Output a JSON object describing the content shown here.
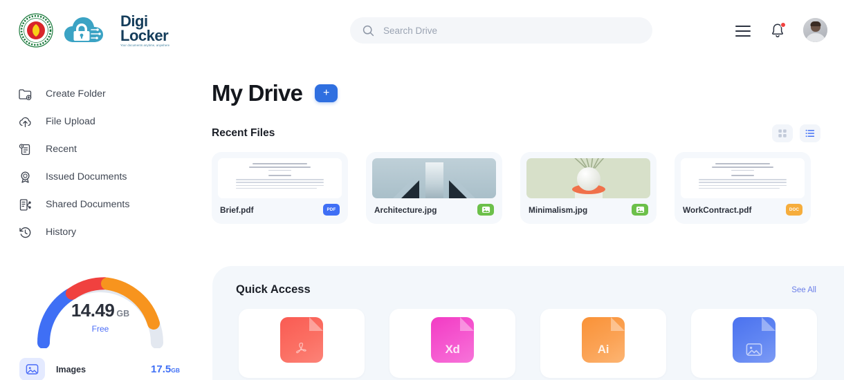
{
  "brand": {
    "seal_name": "bangladesh-government-seal",
    "digi": "Digi",
    "locker": "Locker",
    "tagline": "Your documents anytime, anywhere"
  },
  "search": {
    "placeholder": "Search Drive",
    "value": ""
  },
  "header": {
    "menu_icon": "hamburger-menu-icon",
    "bell_icon": "notification-bell-icon",
    "has_notification": true,
    "avatar": "user-avatar"
  },
  "sidebar": {
    "items": [
      {
        "label": "Create Folder",
        "icon": "folder-plus-icon"
      },
      {
        "label": "File Upload",
        "icon": "cloud-upload-icon"
      },
      {
        "label": "Recent",
        "icon": "recent-document-icon"
      },
      {
        "label": "Issued Documents",
        "icon": "certificate-badge-icon"
      },
      {
        "label": "Shared Documents",
        "icon": "shared-document-icon"
      },
      {
        "label": "History",
        "icon": "history-clock-icon"
      }
    ],
    "storage": {
      "value": "14.49",
      "unit": "GB",
      "state": "Free",
      "segments": [
        {
          "name": "blue",
          "color": "#3f6ff5",
          "portion": 30
        },
        {
          "name": "red",
          "color": "#f0413f",
          "portion": 16
        },
        {
          "name": "orange",
          "color": "#f7941e",
          "portion": 26
        },
        {
          "name": "empty",
          "color": "#e3e8f0",
          "portion": 28
        }
      ],
      "rows": [
        {
          "label": "Images",
          "size": "17.5",
          "unit": "GB",
          "icon": "image-icon",
          "accent": "#3f6ff5"
        }
      ]
    }
  },
  "main": {
    "page_title": "My Drive",
    "add_button": "+",
    "recent": {
      "title": "Recent Files",
      "view_grid_icon": "grid-view-icon",
      "view_list_icon": "list-view-icon",
      "active_view": "list",
      "files": [
        {
          "name": "Brief.pdf",
          "badge": "PDF",
          "badge_type": "pdf",
          "thumb": "document-preview"
        },
        {
          "name": "Architecture.jpg",
          "badge": "image",
          "badge_type": "img",
          "thumb": "architecture-photo"
        },
        {
          "name": "Minimalism.jpg",
          "badge": "image",
          "badge_type": "img",
          "thumb": "minimalism-photo"
        },
        {
          "name": "WorkContract.pdf",
          "badge": "DOC",
          "badge_type": "doc",
          "thumb": "document-preview"
        }
      ]
    },
    "quick_access": {
      "title": "Quick Access",
      "see_all": "See All",
      "cards": [
        {
          "label": "",
          "type": "pdf",
          "icon": "acrobat-pdf-file-icon",
          "color": "#fa5b53"
        },
        {
          "label": "Xd",
          "type": "xd",
          "icon": "adobe-xd-file-icon",
          "color": "#f23bc4"
        },
        {
          "label": "Ai",
          "type": "ai",
          "icon": "adobe-illustrator-file-icon",
          "color": "#f99237"
        },
        {
          "label": "",
          "type": "image",
          "icon": "image-file-icon",
          "color": "#4b72ef"
        }
      ]
    }
  }
}
